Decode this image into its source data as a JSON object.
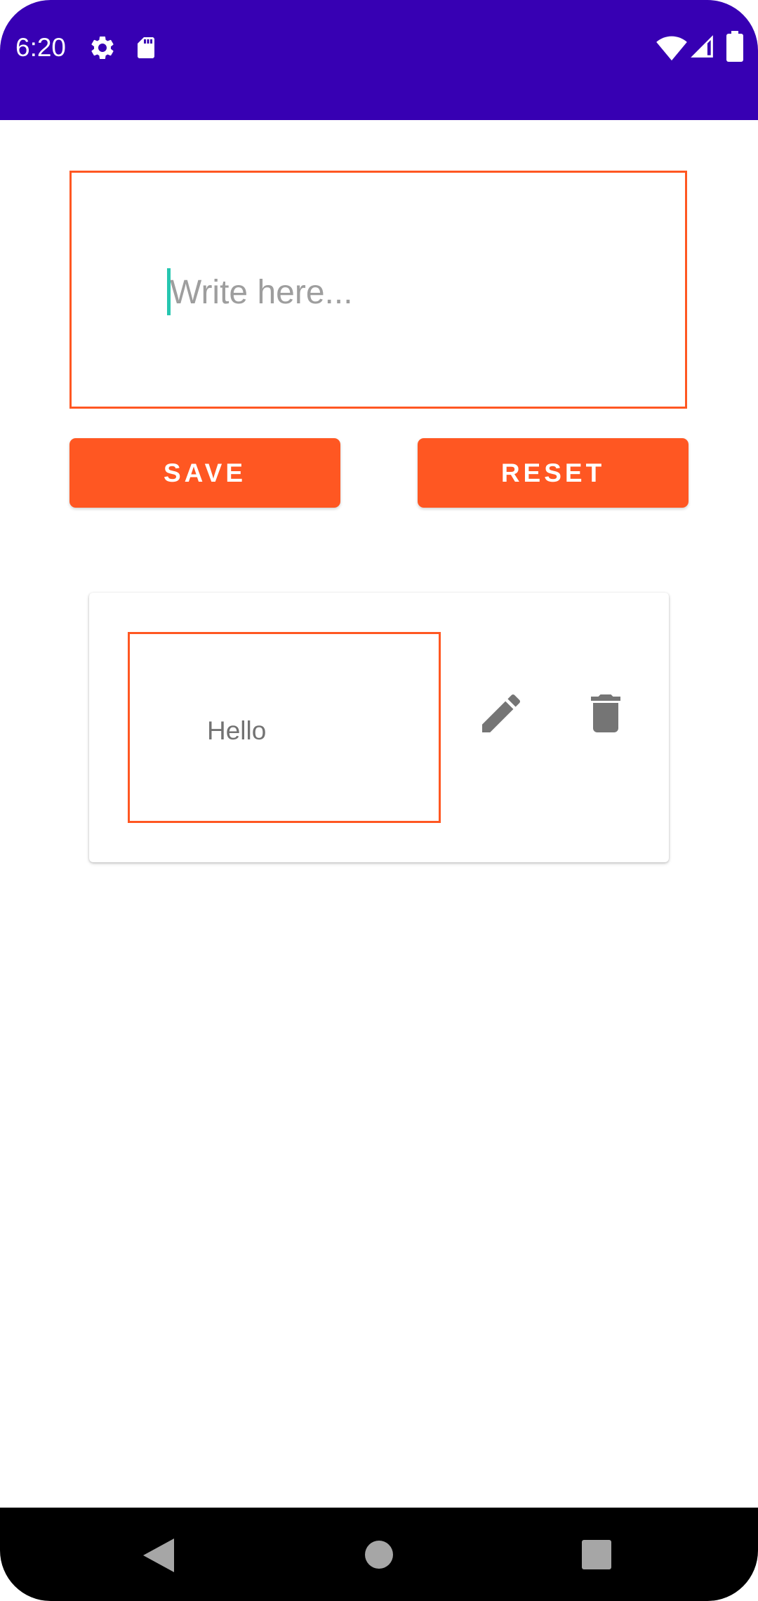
{
  "status_bar": {
    "time": "6:20",
    "color": "#3700b3",
    "left_icons": [
      "gear-icon",
      "sd-card-icon"
    ],
    "right_icons": [
      "wifi-icon",
      "signal-icon",
      "battery-icon"
    ]
  },
  "note_input": {
    "placeholder": "Write here...",
    "value": "",
    "border_color": "#ff5722"
  },
  "buttons": {
    "save_label": "SAVE",
    "reset_label": "RESET",
    "color": "#ff5722"
  },
  "notes": [
    {
      "text": "Hello",
      "actions": [
        "edit-icon",
        "delete-icon"
      ]
    }
  ],
  "nav_bar": {
    "buttons": [
      "back-icon",
      "home-icon",
      "recents-icon"
    ]
  }
}
